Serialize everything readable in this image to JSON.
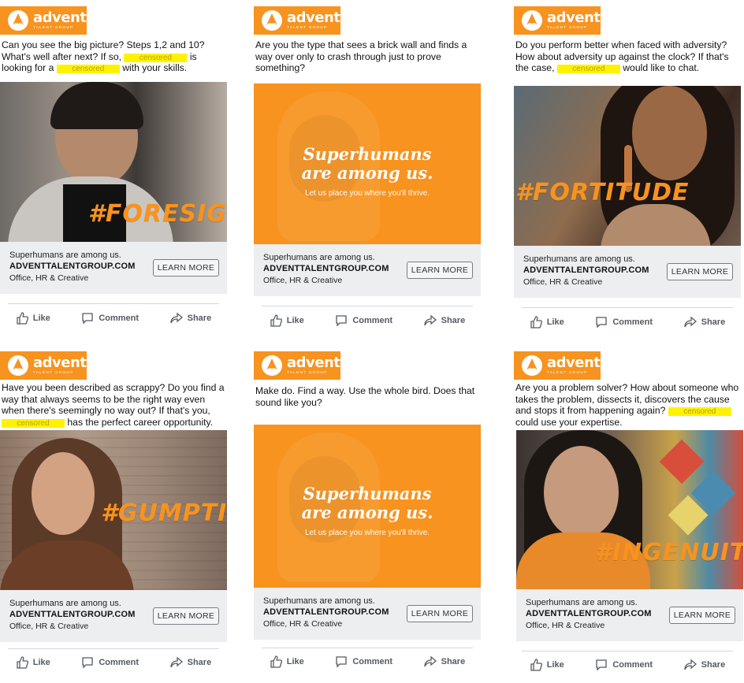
{
  "brand": {
    "name": "advent",
    "sub": "TALENT GROUP",
    "color": "#f7931e"
  },
  "shared": {
    "cta_line1": "Superhumans are among us.",
    "cta_line2": "ADVENTTALENTGROUP.COM",
    "cta_line3": "Office, HR & Creative",
    "learn_more": "LEARN MORE",
    "like": "Like",
    "comment": "Comment",
    "share": "Share",
    "censored": "censored",
    "tag_1": "Superhumans",
    "tag_2": "are among us.",
    "tag_3": "Let us place you where you'll thrive."
  },
  "posts": [
    {
      "copy_a": "Can you see the big picture? Steps 1,2 and 10? What's well after next? If so,",
      "copy_b": "is looking for a",
      "copy_c": "with your skills.",
      "hashtag": "#FORESIGHT"
    },
    {
      "copy": "Are you the type that sees a brick wall and finds a way over only to crash through just to prove something?"
    },
    {
      "copy_a": "Do you perform better when faced with adversity? How about adversity up against the clock? If that's the case,",
      "copy_b": "would like to chat.",
      "hashtag": "#FORTITUDE"
    },
    {
      "copy_a": "Have you been described as scrappy? Do you find a way that always seems to be the right way even when there's seemingly no way out? If that's you,",
      "copy_b": "has the perfect career opportunity.",
      "hashtag": "#GUMPTION"
    },
    {
      "copy": "Make do. Find a way. Use the whole bird. Does that sound like you?"
    },
    {
      "copy_a": "Are you a problem solver? How about someone who takes the problem, dissects it, discovers the cause and stops it from happening again?",
      "copy_b": "could use your expertise.",
      "hashtag": "#INGENUITY"
    }
  ]
}
